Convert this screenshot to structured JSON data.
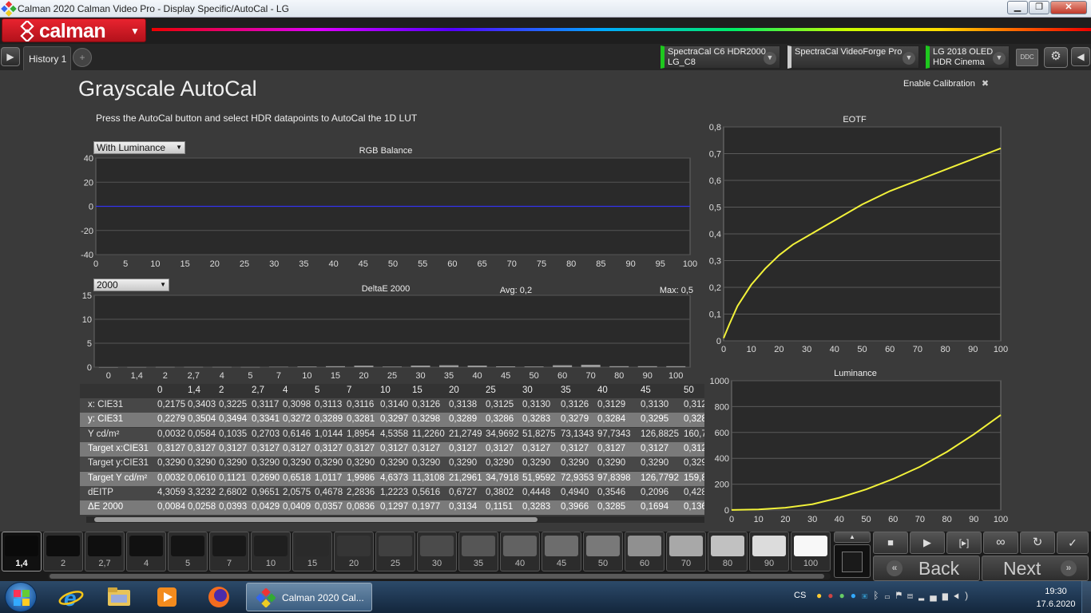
{
  "window": {
    "title": "Calman 2020 Calman Video Pro - Display Specific/AutoCal - LG"
  },
  "brand": {
    "logo": "calman"
  },
  "tabs": {
    "history_label": "History 1",
    "add_label": "+"
  },
  "devices": [
    {
      "line1": "SpectraCal C6 HDR2000",
      "line2": "LG_C8"
    },
    {
      "line1": "SpectraCal VideoForge Pro",
      "line2": ""
    },
    {
      "line1": "LG 2018 OLED",
      "line2": "HDR Cinema"
    }
  ],
  "ddc_label": "DDC",
  "page": {
    "title": "Grayscale AutoCal",
    "instruction": "Press the AutoCal button and select HDR datapoints to AutoCal the 1D LUT",
    "enable_calibration": "Enable Calibration",
    "enable_x": "✖"
  },
  "rgb_chart": {
    "dropdown": "With Luminance",
    "title": "RGB Balance",
    "y_ticks": [
      "40",
      "20",
      "0",
      "-20",
      "-40"
    ],
    "x_ticks": [
      "0",
      "5",
      "10",
      "15",
      "20",
      "25",
      "30",
      "35",
      "40",
      "45",
      "50",
      "55",
      "60",
      "65",
      "70",
      "75",
      "80",
      "85",
      "90",
      "95",
      "100"
    ]
  },
  "de_chart": {
    "dropdown": "2000",
    "title": "DeltaE 2000",
    "avg": "Avg: 0,2",
    "max": "Max: 0,5",
    "y_ticks": [
      "15",
      "10",
      "5",
      "0"
    ],
    "x_ticks": [
      "0",
      "1,4",
      "2",
      "2,7",
      "4",
      "5",
      "7",
      "10",
      "15",
      "20",
      "25",
      "30",
      "35",
      "40",
      "45",
      "50",
      "60",
      "70",
      "80",
      "90",
      "100"
    ]
  },
  "eotf_chart": {
    "title": "EOTF",
    "y_ticks": [
      "0,8",
      "0,7",
      "0,6",
      "0,5",
      "0,4",
      "0,3",
      "0,2",
      "0,1",
      "0"
    ],
    "x_ticks": [
      "0",
      "10",
      "20",
      "30",
      "40",
      "50",
      "60",
      "70",
      "80",
      "90",
      "100"
    ]
  },
  "lum_chart": {
    "title": "Luminance",
    "y_ticks": [
      "1000",
      "800",
      "600",
      "400",
      "200",
      "0"
    ],
    "x_ticks": [
      "0",
      "10",
      "20",
      "30",
      "40",
      "50",
      "60",
      "70",
      "80",
      "90",
      "100"
    ]
  },
  "chart_data": [
    {
      "type": "line",
      "title": "RGB Balance",
      "x": [
        0,
        5,
        10,
        15,
        20,
        25,
        30,
        35,
        40,
        45,
        50,
        55,
        60,
        65,
        70,
        75,
        80,
        85,
        90,
        95,
        100
      ],
      "series": [],
      "ylim": [
        -40,
        40
      ],
      "xlim": [
        0,
        100
      ]
    },
    {
      "type": "bar",
      "title": "DeltaE 2000",
      "categories": [
        "0",
        "1,4",
        "2",
        "2,7",
        "4",
        "5",
        "7",
        "10",
        "15",
        "20",
        "25",
        "30",
        "35",
        "40",
        "45",
        "50",
        "60",
        "70",
        "80",
        "90",
        "100"
      ],
      "values": [
        0.0084,
        0.0258,
        0.0393,
        0.0429,
        0.0409,
        0.0357,
        0.0836,
        0.1297,
        0.1977,
        0.3134,
        0.1151,
        0.3283,
        0.3966,
        0.3285,
        0.1694,
        0.136,
        0.4,
        0.5,
        0.2,
        0.2,
        0.2
      ],
      "ylim": [
        0,
        15
      ]
    },
    {
      "type": "line",
      "title": "EOTF",
      "x": [
        0,
        2,
        5,
        10,
        15,
        20,
        25,
        30,
        40,
        50,
        60,
        70,
        80,
        90,
        100
      ],
      "series": [
        {
          "values": [
            0.01,
            0.06,
            0.13,
            0.21,
            0.27,
            0.32,
            0.36,
            0.39,
            0.45,
            0.51,
            0.56,
            0.6,
            0.64,
            0.68,
            0.72
          ]
        }
      ],
      "xlim": [
        0,
        100
      ],
      "ylim": [
        0,
        0.8
      ]
    },
    {
      "type": "line",
      "title": "Luminance",
      "x": [
        0,
        10,
        20,
        30,
        40,
        50,
        60,
        70,
        80,
        90,
        100
      ],
      "series": [
        {
          "values": [
            1,
            5,
            18,
            45,
            95,
            160,
            240,
            335,
            450,
            585,
            735
          ]
        }
      ],
      "xlim": [
        0,
        100
      ],
      "ylim": [
        0,
        1000
      ]
    }
  ],
  "table": {
    "columns": [
      "0",
      "1,4",
      "2",
      "2,7",
      "4",
      "5",
      "7",
      "10",
      "15",
      "20",
      "25",
      "30",
      "35",
      "40",
      "45",
      "50"
    ],
    "rows": [
      {
        "label": "x: CIE31",
        "values": [
          "0,2175",
          "0,3403",
          "0,3225",
          "0,3117",
          "0,3098",
          "0,3113",
          "0,3116",
          "0,3140",
          "0,3126",
          "0,3138",
          "0,3125",
          "0,3130",
          "0,3126",
          "0,3129",
          "0,3130",
          "0,312"
        ]
      },
      {
        "label": "y: CIE31",
        "values": [
          "0,2279",
          "0,3504",
          "0,3494",
          "0,3341",
          "0,3272",
          "0,3289",
          "0,3281",
          "0,3297",
          "0,3298",
          "0,3289",
          "0,3286",
          "0,3283",
          "0,3279",
          "0,3284",
          "0,3295",
          "0,328"
        ]
      },
      {
        "label": "Y cd/m²",
        "values": [
          "0,0032",
          "0,0584",
          "0,1035",
          "0,2703",
          "0,6146",
          "1,0144",
          "1,8954",
          "4,5358",
          "11,2260",
          "21,2749",
          "34,9692",
          "51,8275",
          "73,1343",
          "97,7343",
          "126,8825",
          "160,7"
        ]
      },
      {
        "label": "Target x:CIE31",
        "values": [
          "0,3127",
          "0,3127",
          "0,3127",
          "0,3127",
          "0,3127",
          "0,3127",
          "0,3127",
          "0,3127",
          "0,3127",
          "0,3127",
          "0,3127",
          "0,3127",
          "0,3127",
          "0,3127",
          "0,3127",
          "0,312"
        ]
      },
      {
        "label": "Target y:CIE31",
        "values": [
          "0,3290",
          "0,3290",
          "0,3290",
          "0,3290",
          "0,3290",
          "0,3290",
          "0,3290",
          "0,3290",
          "0,3290",
          "0,3290",
          "0,3290",
          "0,3290",
          "0,3290",
          "0,3290",
          "0,3290",
          "0,329"
        ]
      },
      {
        "label": "Target Y cd/m²",
        "values": [
          "0,0032",
          "0,0610",
          "0,1121",
          "0,2690",
          "0,6518",
          "1,0117",
          "1,9986",
          "4,6373",
          "11,3108",
          "21,2961",
          "34,7918",
          "51,9592",
          "72,9353",
          "97,8398",
          "126,7792",
          "159,8"
        ]
      },
      {
        "label": "dEITP",
        "values": [
          "4,3059",
          "3,3232",
          "2,6802",
          "0,9651",
          "2,0575",
          "0,4678",
          "2,2836",
          "1,2223",
          "0,5616",
          "0,6727",
          "0,3802",
          "0,4448",
          "0,4940",
          "0,3546",
          "0,2096",
          "0,428"
        ]
      },
      {
        "label": "ΔE 2000",
        "values": [
          "0,0084",
          "0,0258",
          "0,0393",
          "0,0429",
          "0,0409",
          "0,0357",
          "0,0836",
          "0,1297",
          "0,1977",
          "0,3134",
          "0,1151",
          "0,3283",
          "0,3966",
          "0,3285",
          "0,1694",
          "0,136"
        ]
      }
    ]
  },
  "patches": [
    {
      "label": "1,4",
      "color": "#0b0b0b"
    },
    {
      "label": "2",
      "color": "#0d0d0d"
    },
    {
      "label": "2,7",
      "color": "#0f0f0f"
    },
    {
      "label": "4",
      "color": "#111111"
    },
    {
      "label": "5",
      "color": "#141414"
    },
    {
      "label": "7",
      "color": "#181818"
    },
    {
      "label": "10",
      "color": "#1f1f1f"
    },
    {
      "label": "15",
      "color": "#2a2a2a"
    },
    {
      "label": "20",
      "color": "#353535"
    },
    {
      "label": "25",
      "color": "#404040"
    },
    {
      "label": "30",
      "color": "#4b4b4b"
    },
    {
      "label": "35",
      "color": "#565656"
    },
    {
      "label": "40",
      "color": "#626262"
    },
    {
      "label": "45",
      "color": "#6d6d6d"
    },
    {
      "label": "50",
      "color": "#797979"
    },
    {
      "label": "60",
      "color": "#909090"
    },
    {
      "label": "70",
      "color": "#a8a8a8"
    },
    {
      "label": "80",
      "color": "#c1c1c1"
    },
    {
      "label": "90",
      "color": "#dcdcdc"
    },
    {
      "label": "100",
      "color": "#f8f8f8"
    }
  ],
  "nav": {
    "back": "Back",
    "next": "Next"
  },
  "taskbar": {
    "task_label": "Calman 2020 Cal...",
    "lang": "CS",
    "time": "19:30",
    "date": "17.6.2020"
  }
}
